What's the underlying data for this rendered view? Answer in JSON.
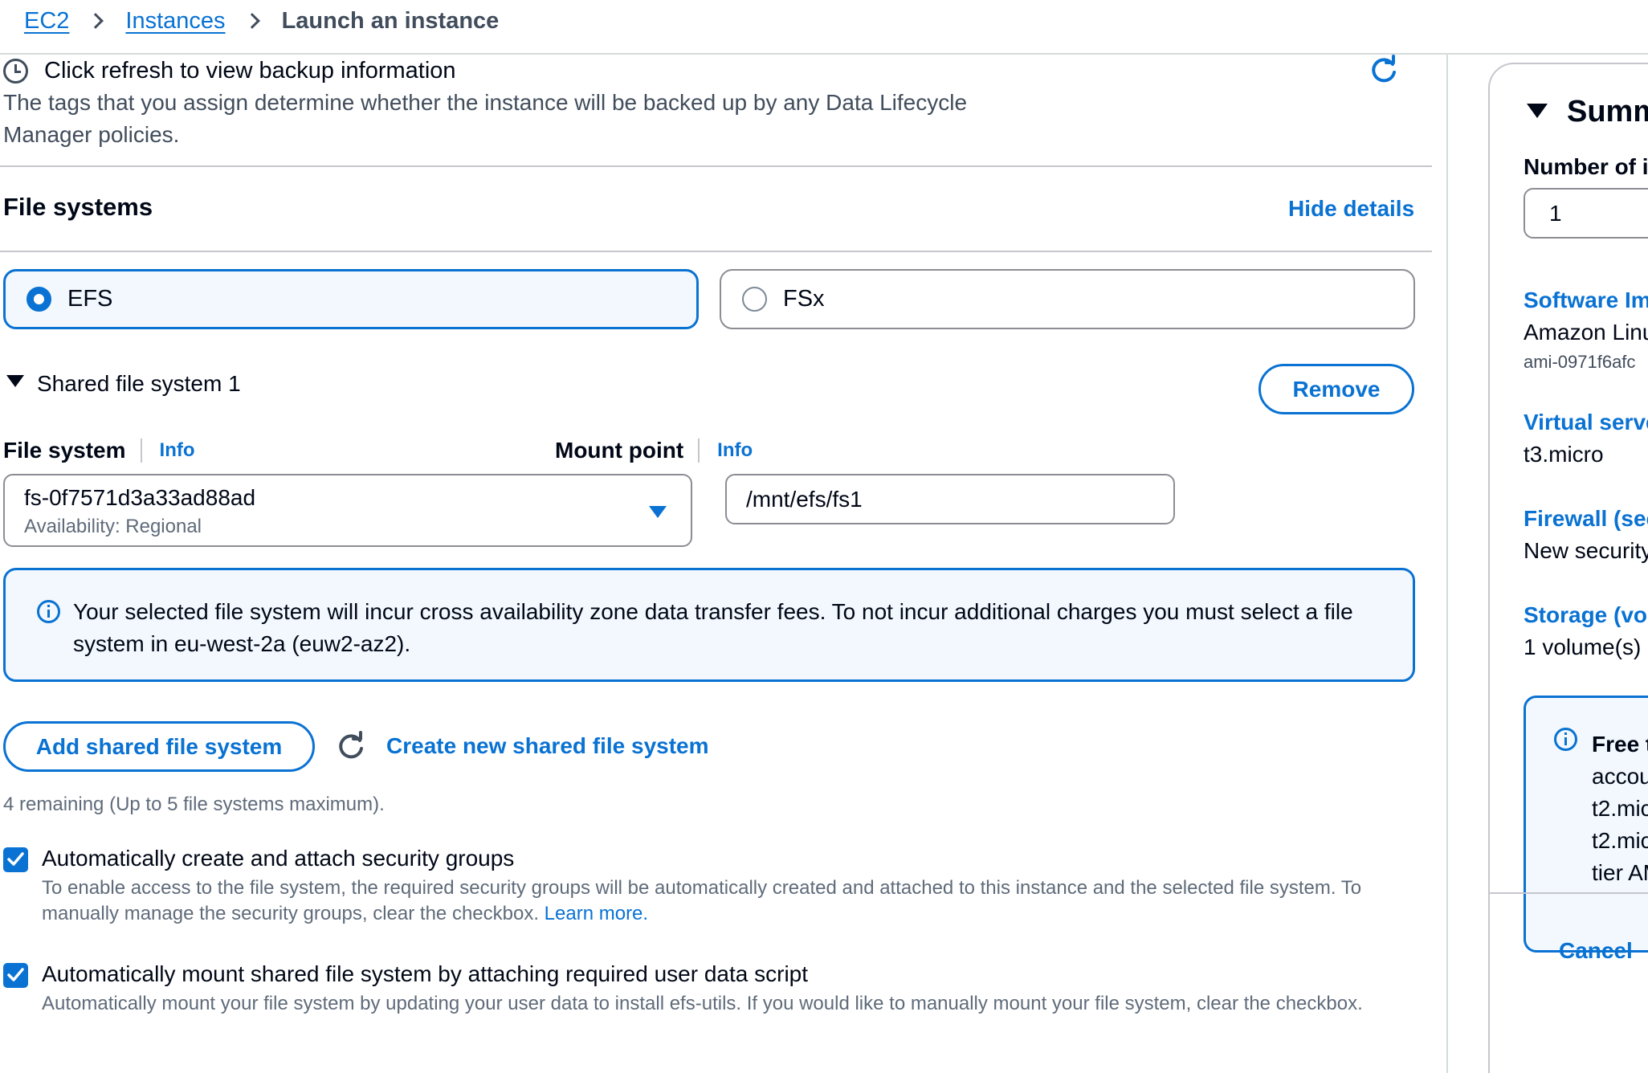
{
  "breadcrumb": {
    "items": [
      "EC2",
      "Instances"
    ],
    "current": "Launch an instance"
  },
  "backup": {
    "title": "Click refresh to view backup information",
    "description": "The tags that you assign determine whether the instance will be backed up by any Data Lifecycle Manager policies.",
    "icon": "clock-icon",
    "refresh_icon": "refresh-icon"
  },
  "file_systems": {
    "title": "File systems",
    "hide_details": "Hide details",
    "options": [
      {
        "label": "EFS",
        "selected": true
      },
      {
        "label": "FSx",
        "selected": false
      }
    ],
    "shared": {
      "label": "Shared file system 1",
      "remove": "Remove",
      "file_system_label": "File system",
      "mount_point_label": "Mount point",
      "info": "Info",
      "file_system_value": "fs-0f7571d3a33ad88ad",
      "file_system_sub": "Availability: Regional",
      "mount_point_value": "/mnt/efs/fs1"
    },
    "alert": "Your selected file system will incur cross availability zone data transfer fees. To not incur additional charges you must select a file system in eu-west-2a (euw2-az2).",
    "add_button": "Add shared file system",
    "create_link": "Create new shared file system",
    "remaining": "4 remaining (Up to 5 file systems maximum).",
    "checkbox1": {
      "title": "Automatically create and attach security groups",
      "desc": "To enable access to the file system, the required security groups will be automatically created and attached to this instance and the selected file system. To manually manage the security groups, clear the checkbox.",
      "learn_more": "Learn more.",
      "checked": true
    },
    "checkbox2": {
      "title": "Automatically mount shared file system by attaching required user data script",
      "desc": "Automatically mount your file system by updating your user data to install efs-utils. If you would like to manually mount your file system, clear the checkbox.",
      "checked": true
    }
  },
  "summary": {
    "title": "Summ",
    "number_label": "Number of i",
    "number_value": "1",
    "software_head": "Software Im",
    "software_value": "Amazon Linu",
    "software_sub": "ami-0971f6afc",
    "virtual_head": "Virtual serve",
    "virtual_value": "t3.micro",
    "firewall_head": "Firewall (sec",
    "firewall_value": "New security",
    "storage_head": "Storage (vol",
    "storage_value": "1 volume(s) -",
    "alert_lines": [
      "Free t",
      "accou",
      "t2.mic",
      "t2.mic",
      "tier AM"
    ],
    "cancel": "Cancel"
  },
  "colors": {
    "accent": "#0972d3",
    "text": "#000716",
    "muted": "#5f6b7a",
    "alert_bg": "#f2f8fd"
  }
}
